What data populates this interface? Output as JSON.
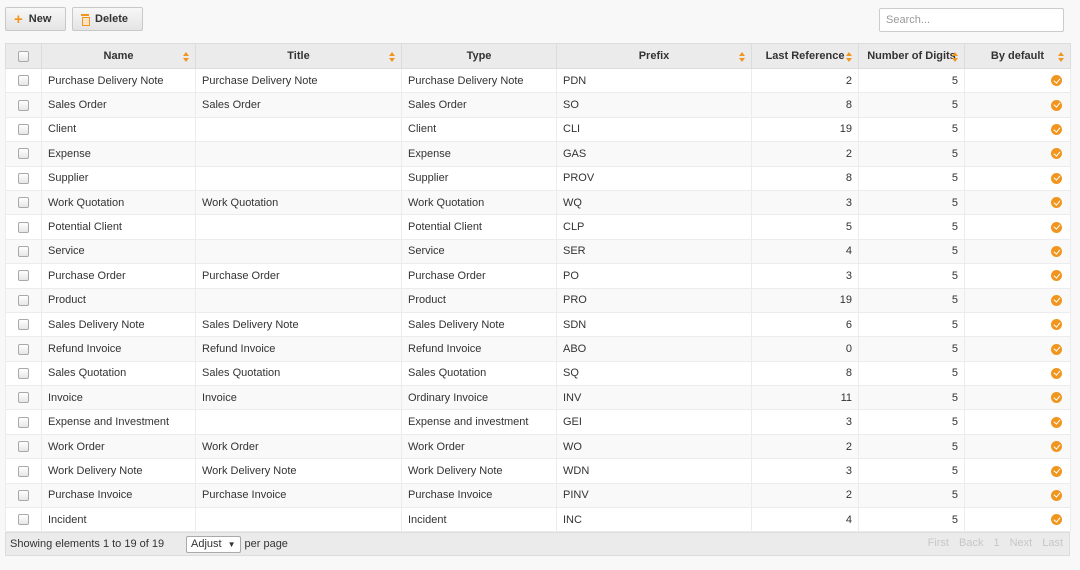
{
  "toolbar": {
    "new_label": "New",
    "delete_label": "Delete",
    "search_placeholder": "Search..."
  },
  "colors": {
    "accent": "#f0961e"
  },
  "table": {
    "headers": {
      "name": "Name",
      "title": "Title",
      "type": "Type",
      "prefix": "Prefix",
      "last_reference": "Last Reference",
      "number_of_digits": "Number of Digits",
      "by_default": "By default"
    },
    "rows": [
      {
        "name": "Purchase Delivery Note",
        "title": "Purchase Delivery Note",
        "type": "Purchase Delivery Note",
        "prefix": "PDN",
        "last_reference": "2",
        "digits": "5",
        "default": true
      },
      {
        "name": "Sales Order",
        "title": "Sales Order",
        "type": "Sales Order",
        "prefix": "SO",
        "last_reference": "8",
        "digits": "5",
        "default": true
      },
      {
        "name": "Client",
        "title": "",
        "type": "Client",
        "prefix": "CLI",
        "last_reference": "19",
        "digits": "5",
        "default": true
      },
      {
        "name": "Expense",
        "title": "",
        "type": "Expense",
        "prefix": "GAS",
        "last_reference": "2",
        "digits": "5",
        "default": true
      },
      {
        "name": "Supplier",
        "title": "",
        "type": "Supplier",
        "prefix": "PROV",
        "last_reference": "8",
        "digits": "5",
        "default": true
      },
      {
        "name": "Work Quotation",
        "title": "Work Quotation",
        "type": "Work Quotation",
        "prefix": "WQ",
        "last_reference": "3",
        "digits": "5",
        "default": true
      },
      {
        "name": "Potential Client",
        "title": "",
        "type": "Potential Client",
        "prefix": "CLP",
        "last_reference": "5",
        "digits": "5",
        "default": true
      },
      {
        "name": "Service",
        "title": "",
        "type": "Service",
        "prefix": "SER",
        "last_reference": "4",
        "digits": "5",
        "default": true
      },
      {
        "name": "Purchase Order",
        "title": "Purchase Order",
        "type": "Purchase Order",
        "prefix": "PO",
        "last_reference": "3",
        "digits": "5",
        "default": true
      },
      {
        "name": "Product",
        "title": "",
        "type": "Product",
        "prefix": "PRO",
        "last_reference": "19",
        "digits": "5",
        "default": true
      },
      {
        "name": "Sales Delivery Note",
        "title": "Sales Delivery Note",
        "type": "Sales Delivery Note",
        "prefix": "SDN",
        "last_reference": "6",
        "digits": "5",
        "default": true
      },
      {
        "name": "Refund Invoice",
        "title": "Refund Invoice",
        "type": "Refund Invoice",
        "prefix": "ABO",
        "last_reference": "0",
        "digits": "5",
        "default": true
      },
      {
        "name": "Sales Quotation",
        "title": "Sales Quotation",
        "type": "Sales Quotation",
        "prefix": "SQ",
        "last_reference": "8",
        "digits": "5",
        "default": true
      },
      {
        "name": "Invoice",
        "title": "Invoice",
        "type": "Ordinary Invoice",
        "prefix": "INV",
        "last_reference": "11",
        "digits": "5",
        "default": true
      },
      {
        "name": "Expense and Investment",
        "title": "",
        "type": "Expense and investment",
        "prefix": "GEI",
        "last_reference": "3",
        "digits": "5",
        "default": true
      },
      {
        "name": "Work Order",
        "title": "Work Order",
        "type": "Work Order",
        "prefix": "WO",
        "last_reference": "2",
        "digits": "5",
        "default": true
      },
      {
        "name": "Work Delivery Note",
        "title": "Work Delivery Note",
        "type": "Work Delivery Note",
        "prefix": "WDN",
        "last_reference": "3",
        "digits": "5",
        "default": true
      },
      {
        "name": "Purchase Invoice",
        "title": "Purchase Invoice",
        "type": "Purchase Invoice",
        "prefix": "PINV",
        "last_reference": "2",
        "digits": "5",
        "default": true
      },
      {
        "name": "Incident",
        "title": "",
        "type": "Incident",
        "prefix": "INC",
        "last_reference": "4",
        "digits": "5",
        "default": true
      }
    ]
  },
  "footer": {
    "showing": "Showing elements 1 to 19 of 19",
    "page_size": "Adjust",
    "per_page": "per page",
    "first": "First",
    "back": "Back",
    "page": "1",
    "next": "Next",
    "last": "Last"
  }
}
